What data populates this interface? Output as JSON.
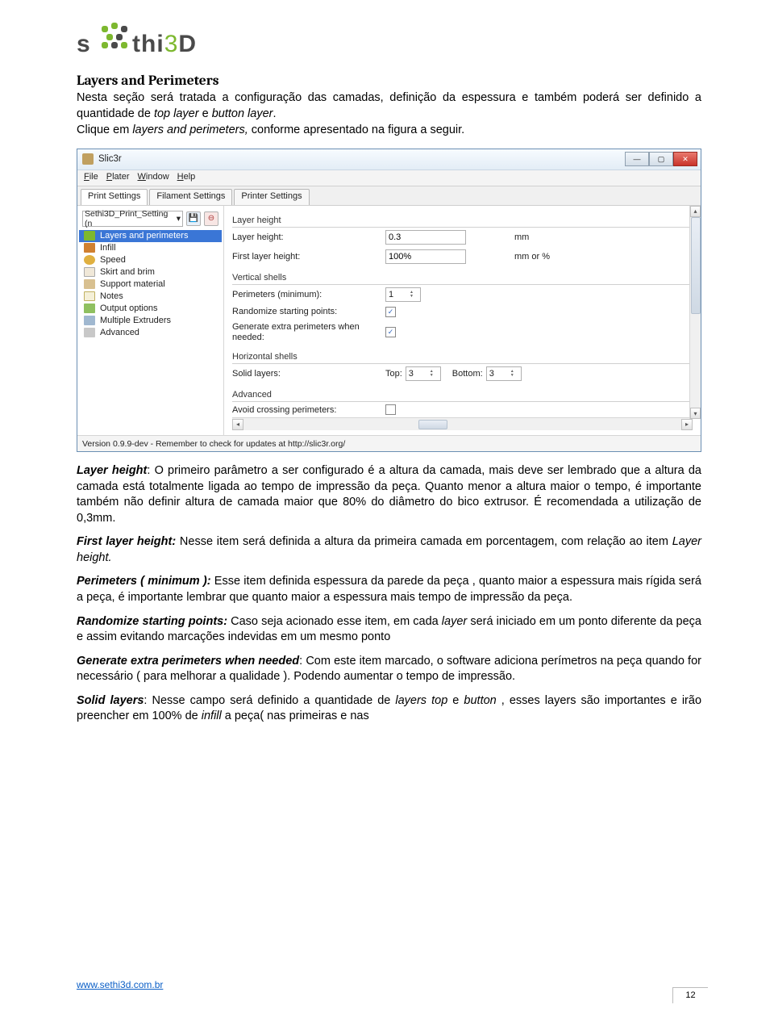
{
  "logo": {
    "text_pre": "s",
    "text_mid": "thi",
    "text_3": "3",
    "text_d": "D"
  },
  "heading": "Layers and Perimeters",
  "intro1_a": "Nesta seção será tratada a configuração das camadas, definição da espessura e também poderá ser definido a quantidade de ",
  "intro1_b": "top layer",
  "intro1_c": " e ",
  "intro1_d": "button layer",
  "intro1_e": ".",
  "intro2_a": "Clique em ",
  "intro2_b": "layers and perimeters,",
  "intro2_c": " conforme apresentado na figura a seguir.",
  "app": {
    "title": "Slic3r",
    "menus": {
      "file": "File",
      "plater": "Plater",
      "window": "Window",
      "help": "Help"
    },
    "tabs": {
      "print": "Print Settings",
      "filament": "Filament Settings",
      "printer": "Printer Settings"
    },
    "profile": "Sethi3D_Print_Setting (n",
    "sidebar": [
      "Layers and perimeters",
      "Infill",
      "Speed",
      "Skirt and brim",
      "Support material",
      "Notes",
      "Output options",
      "Multiple Extruders",
      "Advanced"
    ],
    "sections": {
      "layer_height": "Layer height",
      "vertical": "Vertical shells",
      "horizontal": "Horizontal shells",
      "advanced": "Advanced"
    },
    "fields": {
      "layer_height": {
        "label": "Layer height:",
        "value": "0.3",
        "unit": "mm"
      },
      "first_layer": {
        "label": "First layer height:",
        "value": "100%",
        "unit": "mm or %"
      },
      "perimeters": {
        "label": "Perimeters (minimum):",
        "value": "1"
      },
      "randomize": {
        "label": "Randomize starting points:",
        "checked": "✓"
      },
      "extra_perim": {
        "label": "Generate extra perimeters when needed:",
        "checked": "✓"
      },
      "solid_layers": {
        "label": "Solid layers:",
        "top_lbl": "Top:",
        "top": "3",
        "bot_lbl": "Bottom:",
        "bot": "3"
      },
      "avoid_cross": {
        "label": "Avoid crossing perimeters:"
      }
    },
    "status": "Version 0.9.9-dev - Remember to check for updates at http://slic3r.org/"
  },
  "p_layerheight_a": "Layer height",
  "p_layerheight_b": ": O primeiro parâmetro a ser configurado é a altura da camada, mais deve ser lembrado que a altura da camada está totalmente ligada ao tempo de impressão da peça. Quanto menor a altura maior o tempo, é importante também não definir altura de camada maior que 80% do diâmetro do bico extrusor. É recomendada a utilização de 0,3mm.",
  "p_firstlayer_a": "First layer height:",
  "p_firstlayer_b": " Nesse item será definida a altura da primeira camada em porcentagem,  com relação ao item ",
  "p_firstlayer_c": "Layer height.",
  "p_perim_a": "Perimeters ( minimum ):",
  "p_perim_b": " Esse item definida espessura da parede da peça , quanto maior a espessura mais rígida será a peça, é importante lembrar que quanto maior a espessura mais tempo de impressão da peça.",
  "p_rand_a": "Randomize starting points:",
  "p_rand_b": " Caso seja acionado esse item, em cada ",
  "p_rand_c": "layer",
  "p_rand_d": " será iniciado em um ponto diferente da peça e assim evitando marcações indevidas em um mesmo ponto",
  "p_gen_a": "Generate extra perimeters when needed",
  "p_gen_b": ": Com este item marcado, o software adiciona perímetros na peça quando for necessário ( para melhorar a qualidade ). Podendo aumentar o tempo de impressão.",
  "p_solid_a": "Solid layers",
  "p_solid_b": ": Nesse campo será definido a quantidade de ",
  "p_solid_c": "layers  top",
  "p_solid_d": " e ",
  "p_solid_e": "button",
  "p_solid_f": " , esses layers são importantes e irão preencher em 100% de ",
  "p_solid_g": "infill",
  "p_solid_h": "  a peça( nas primeiras e nas",
  "footer_link": "www.sethi3d.com.br",
  "page_number": "12"
}
